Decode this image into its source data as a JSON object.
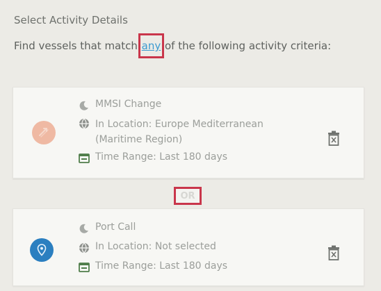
{
  "header": {
    "title": "Select Activity Details",
    "desc_before": "Find vessels that match ",
    "match_value": "any",
    "desc_after": " of the following activity criteria:"
  },
  "criteria": [
    {
      "type": "MMSI Change",
      "location": "In Location: Europe Mediterranean (Maritime Region)",
      "time_range": "Time Range: Last 180 days"
    },
    {
      "type": "Port Call",
      "location": "In Location: Not selected",
      "time_range": "Time Range: Last 180 days"
    }
  ],
  "connector": "OR",
  "icons": {
    "type": "moon-icon",
    "location": "globe-icon",
    "time_range": "calendar-icon",
    "delete": "trash-icon",
    "mmsi_badge": "swap-icon",
    "port_badge": "location-pin-icon"
  },
  "colors": {
    "link": "#3b9ad0",
    "highlight": "#c9364b",
    "mmsi_badge": "#efb9a3",
    "port_badge": "#2b7fc0"
  }
}
